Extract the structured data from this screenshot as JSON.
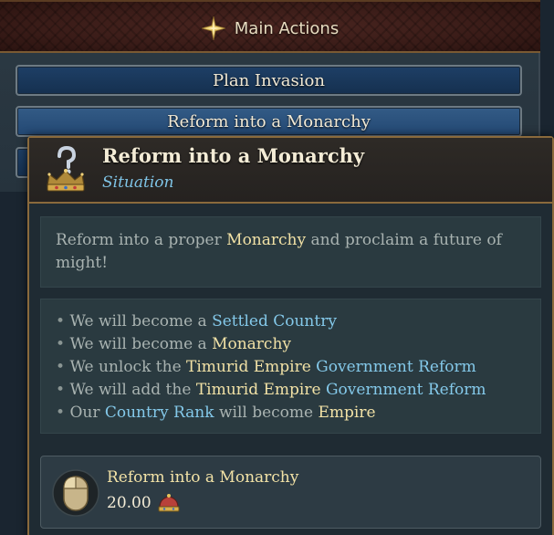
{
  "header": {
    "title": "Main Actions",
    "icon": "compass-star-icon"
  },
  "actions": [
    {
      "label": "Plan Invasion"
    },
    {
      "label": "Reform into a Monarchy"
    },
    {
      "label": ""
    }
  ],
  "tooltip": {
    "title": "Reform into a Monarchy",
    "subtitle": "Situation",
    "icon": "crown-question-icon",
    "description": {
      "p1": "Reform into a proper ",
      "h1": "Monarchy",
      "p2": " and proclaim a future of might!"
    },
    "effects": [
      {
        "bullet": "• ",
        "t1": "We will become a ",
        "h1": "Settled Country"
      },
      {
        "bullet": "• ",
        "t1": "We will become a ",
        "h1": "Monarchy"
      },
      {
        "bullet": "• ",
        "t1": "We unlock the ",
        "h1": "Timurid Empire",
        "t2": " ",
        "h2": "Government Reform"
      },
      {
        "bullet": "• ",
        "t1": "We will add the ",
        "h1": "Timurid Empire",
        "t2": " ",
        "h2": "Government Reform"
      },
      {
        "bullet": "• ",
        "t1": "Our ",
        "h1": "Country Rank",
        "t2": " will become ",
        "h2": "Empire"
      }
    ],
    "cost": {
      "label": "Reform into a Monarchy",
      "value": "20.00",
      "icon": "crown-icon"
    }
  },
  "colors": {
    "gold_highlight": "#f2e2a6",
    "blue_highlight": "#84c9ea",
    "border_gold": "#8a6a3c"
  }
}
